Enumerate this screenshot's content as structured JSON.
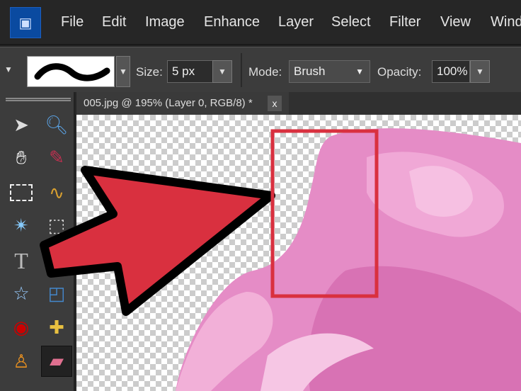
{
  "menubar": {
    "items": [
      "File",
      "Edit",
      "Image",
      "Enhance",
      "Layer",
      "Select",
      "Filter",
      "View",
      "Windo"
    ]
  },
  "options": {
    "size_label": "Size:",
    "size_value": "5 px",
    "mode_label": "Mode:",
    "mode_value": "Brush",
    "opacity_label": "Opacity:",
    "opacity_value": "100%"
  },
  "document_tab": {
    "title": "005.jpg @ 195% (Layer 0, RGB/8) *",
    "close": "x"
  },
  "toolbox": {
    "active_tool": "eraser"
  },
  "colors": {
    "arrow": "#d9303f",
    "highlight": "#d9303f",
    "rose": "#e889c4"
  }
}
